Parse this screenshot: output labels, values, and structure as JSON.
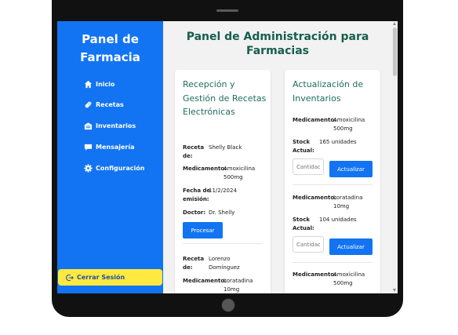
{
  "sidebar": {
    "title": "Panel de Farmacia",
    "items": [
      {
        "label": "Inicio",
        "icon": "home-icon"
      },
      {
        "label": "Recetas",
        "icon": "pill-icon"
      },
      {
        "label": "Inventarios",
        "icon": "warehouse-icon"
      },
      {
        "label": "Mensajería",
        "icon": "chat-icon"
      },
      {
        "label": "Configuración",
        "icon": "gear-icon"
      }
    ],
    "logout": {
      "label": "Cerrar Sesión",
      "icon": "logout-icon"
    }
  },
  "main": {
    "title": "Panel de Administración para Farmacias"
  },
  "prescriptions": {
    "title": "Recepción y Gestión de Recetas Electrónicas",
    "labels": {
      "recipient": "Receta de:",
      "medication": "Medicamento:",
      "date": "Fecha de emisión:",
      "doctor": "Doctor:"
    },
    "items": [
      {
        "recipient": "Shelly Black",
        "medication": "Amoxicilina 500mg",
        "date": "11/2/2024",
        "doctor": "Dr. Shelly",
        "action": "Procesar"
      },
      {
        "recipient": "Lorenzo Domínguez",
        "medication": "Loratadina 10mg"
      }
    ]
  },
  "inventory": {
    "title": "Actualización de Inventarios",
    "labels": {
      "medication": "Medicamento:",
      "stock": "Stock Actual:"
    },
    "quantity_placeholder": "Cantidad",
    "items": [
      {
        "medication": "Amoxicilina 500mg",
        "stock": "165 unidades",
        "action": "Actualizar"
      },
      {
        "medication": "Loratadina 10mg",
        "stock": "104 unidades",
        "action": "Actualizar"
      },
      {
        "medication": "Amoxicilina 500mg"
      }
    ]
  },
  "colors": {
    "sidebar_bg": "#1274f2",
    "accent_yellow": "#ffe940",
    "title_green": "#155f4c",
    "button_blue": "#1274f2"
  }
}
